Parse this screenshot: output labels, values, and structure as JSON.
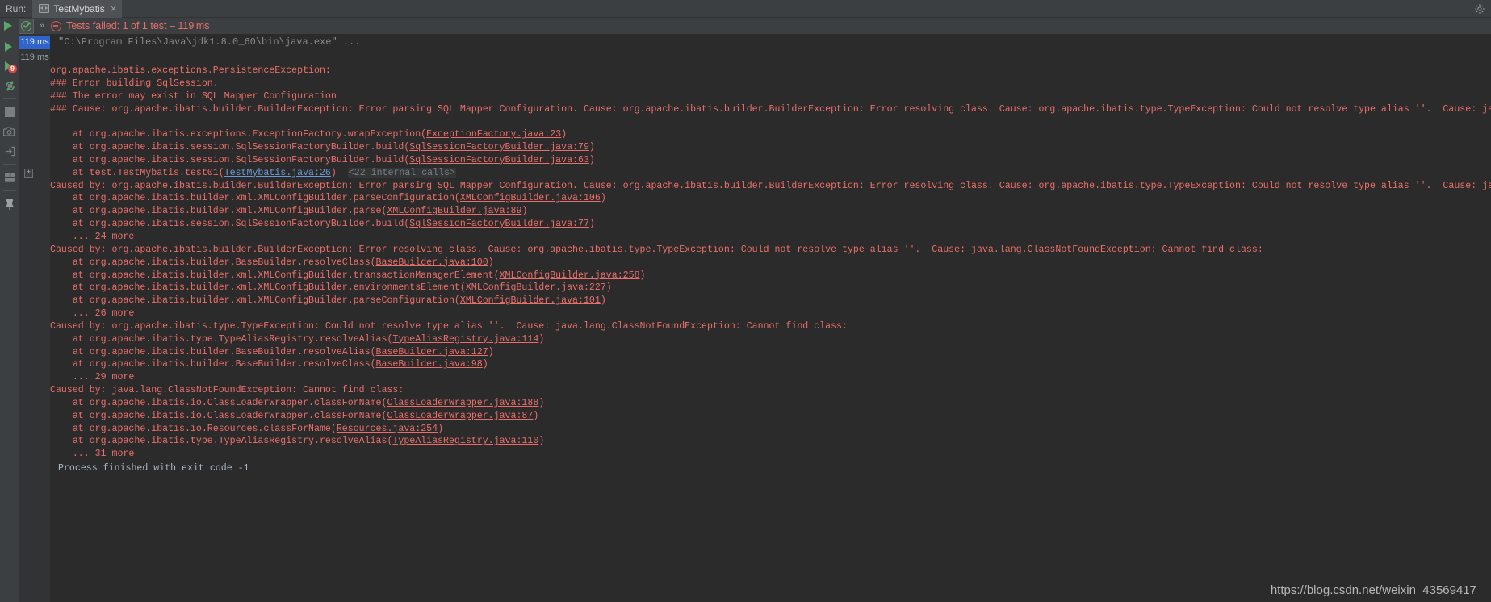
{
  "window": {
    "run_label": "Run:",
    "tab_title": "TestMybatis",
    "tab_close": "×",
    "settings_icon": "gear-icon"
  },
  "toolbar": {
    "rerun_icon": "run-triangle-icon",
    "ok_icon": "test-passed-circle-icon",
    "expand_chevrons": "»",
    "fail_icon": "test-failed-circle-icon",
    "status_text": "Tests failed: 1 of 1 test – 119 ms"
  },
  "sidebar": {
    "items": [
      {
        "name": "rerun-button",
        "icon": "run-triangle-icon",
        "badge": ""
      },
      {
        "name": "rerun-failed-tests-button",
        "icon": "run-triangle-icon",
        "badge": "9"
      },
      {
        "name": "toggle-auto-test-button",
        "icon": "refresh-arrows-icon",
        "badge": ""
      },
      {
        "name": "stop-button",
        "icon": "stop-square-icon",
        "badge": ""
      },
      {
        "name": "export-test-results-button",
        "icon": "camera-icon",
        "badge": ""
      },
      {
        "name": "import-test-results-button",
        "icon": "import-arrow-icon",
        "badge": ""
      },
      {
        "name": "layout-settings-button",
        "icon": "layout-icon",
        "badge": ""
      },
      {
        "name": "pin-tab-button",
        "icon": "pin-icon",
        "badge": ""
      }
    ]
  },
  "console": {
    "duration_selected": "119 ms",
    "duration_second": "119 ms",
    "command_line": "\"C:\\Program Files\\Java\\jdk1.8.0_60\\bin\\java.exe\" ...",
    "process_finished": "Process finished with exit code -1",
    "watermark": "https://blog.csdn.net/weixin_43569417",
    "lines": [
      {
        "type": "plain",
        "indent": 0,
        "text": "org.apache.ibatis.exceptions.PersistenceException: "
      },
      {
        "type": "plain",
        "indent": 0,
        "text": "### Error building SqlSession."
      },
      {
        "type": "plain",
        "indent": 0,
        "text": "### The error may exist in SQL Mapper Configuration"
      },
      {
        "type": "plain",
        "indent": 0,
        "text": "### Cause: org.apache.ibatis.builder.BuilderException: Error parsing SQL Mapper Configuration. Cause: org.apache.ibatis.builder.BuilderException: Error resolving class. Cause: org.apache.ibatis.type.TypeException: Could not resolve type alias ''.  Cause: java.lang.ClassNotFoundException: Cann"
      },
      {
        "type": "blank"
      },
      {
        "type": "link",
        "indent": 1,
        "pre": "at org.apache.ibatis.exceptions.ExceptionFactory.wrapException(",
        "link": "ExceptionFactory.java:23",
        "post": ")"
      },
      {
        "type": "link",
        "indent": 1,
        "pre": "at org.apache.ibatis.session.SqlSessionFactoryBuilder.build(",
        "link": "SqlSessionFactoryBuilder.java:79",
        "post": ")"
      },
      {
        "type": "link",
        "indent": 1,
        "pre": "at org.apache.ibatis.session.SqlSessionFactoryBuilder.build(",
        "link": "SqlSessionFactoryBuilder.java:63",
        "post": ")"
      },
      {
        "type": "test-frame",
        "indent": 1,
        "expander": "+",
        "pre": "at test.TestMybatis.test01(",
        "link": "TestMybatis.java:26",
        "post": ")",
        "internal": "<22 internal calls>"
      },
      {
        "type": "plain",
        "indent": 0,
        "text": "Caused by: org.apache.ibatis.builder.BuilderException: Error parsing SQL Mapper Configuration. Cause: org.apache.ibatis.builder.BuilderException: Error resolving class. Cause: org.apache.ibatis.type.TypeException: Could not resolve type alias ''.  Cause: java.lang.ClassNotFoundException: Cann"
      },
      {
        "type": "link",
        "indent": 1,
        "pre": "at org.apache.ibatis.builder.xml.XMLConfigBuilder.parseConfiguration(",
        "link": "XMLConfigBuilder.java:106",
        "post": ")"
      },
      {
        "type": "link",
        "indent": 1,
        "pre": "at org.apache.ibatis.builder.xml.XMLConfigBuilder.parse(",
        "link": "XMLConfigBuilder.java:89",
        "post": ")"
      },
      {
        "type": "link",
        "indent": 1,
        "pre": "at org.apache.ibatis.session.SqlSessionFactoryBuilder.build(",
        "link": "SqlSessionFactoryBuilder.java:77",
        "post": ")"
      },
      {
        "type": "plain",
        "indent": 1,
        "text": "... 24 more"
      },
      {
        "type": "plain",
        "indent": 0,
        "text": "Caused by: org.apache.ibatis.builder.BuilderException: Error resolving class. Cause: org.apache.ibatis.type.TypeException: Could not resolve type alias ''.  Cause: java.lang.ClassNotFoundException: Cannot find class: "
      },
      {
        "type": "link",
        "indent": 1,
        "pre": "at org.apache.ibatis.builder.BaseBuilder.resolveClass(",
        "link": "BaseBuilder.java:100",
        "post": ")"
      },
      {
        "type": "link",
        "indent": 1,
        "pre": "at org.apache.ibatis.builder.xml.XMLConfigBuilder.transactionManagerElement(",
        "link": "XMLConfigBuilder.java:258",
        "post": ")"
      },
      {
        "type": "link",
        "indent": 1,
        "pre": "at org.apache.ibatis.builder.xml.XMLConfigBuilder.environmentsElement(",
        "link": "XMLConfigBuilder.java:227",
        "post": ")"
      },
      {
        "type": "link",
        "indent": 1,
        "pre": "at org.apache.ibatis.builder.xml.XMLConfigBuilder.parseConfiguration(",
        "link": "XMLConfigBuilder.java:101",
        "post": ")"
      },
      {
        "type": "plain",
        "indent": 1,
        "text": "... 26 more"
      },
      {
        "type": "plain",
        "indent": 0,
        "text": "Caused by: org.apache.ibatis.type.TypeException: Could not resolve type alias ''.  Cause: java.lang.ClassNotFoundException: Cannot find class: "
      },
      {
        "type": "link",
        "indent": 1,
        "pre": "at org.apache.ibatis.type.TypeAliasRegistry.resolveAlias(",
        "link": "TypeAliasRegistry.java:114",
        "post": ")"
      },
      {
        "type": "link",
        "indent": 1,
        "pre": "at org.apache.ibatis.builder.BaseBuilder.resolveAlias(",
        "link": "BaseBuilder.java:127",
        "post": ")"
      },
      {
        "type": "link",
        "indent": 1,
        "pre": "at org.apache.ibatis.builder.BaseBuilder.resolveClass(",
        "link": "BaseBuilder.java:98",
        "post": ")"
      },
      {
        "type": "plain",
        "indent": 1,
        "text": "... 29 more"
      },
      {
        "type": "plain",
        "indent": 0,
        "text": "Caused by: java.lang.ClassNotFoundException: Cannot find class: "
      },
      {
        "type": "link",
        "indent": 1,
        "pre": "at org.apache.ibatis.io.ClassLoaderWrapper.classForName(",
        "link": "ClassLoaderWrapper.java:188",
        "post": ")"
      },
      {
        "type": "link",
        "indent": 1,
        "pre": "at org.apache.ibatis.io.ClassLoaderWrapper.classForName(",
        "link": "ClassLoaderWrapper.java:87",
        "post": ")"
      },
      {
        "type": "link",
        "indent": 1,
        "pre": "at org.apache.ibatis.io.Resources.classForName(",
        "link": "Resources.java:254",
        "post": ")"
      },
      {
        "type": "link",
        "indent": 1,
        "pre": "at org.apache.ibatis.type.TypeAliasRegistry.resolveAlias(",
        "link": "TypeAliasRegistry.java:110",
        "post": ")"
      },
      {
        "type": "plain",
        "indent": 1,
        "text": "... 31 more"
      }
    ]
  },
  "colors": {
    "error_red": "#ea6f6b",
    "link_blue": "#6c9ad6",
    "console_bg": "#2b2b2b",
    "chrome_bg": "#3c3f41",
    "selection_blue": "#2f65ca",
    "run_green": "#59a869"
  }
}
